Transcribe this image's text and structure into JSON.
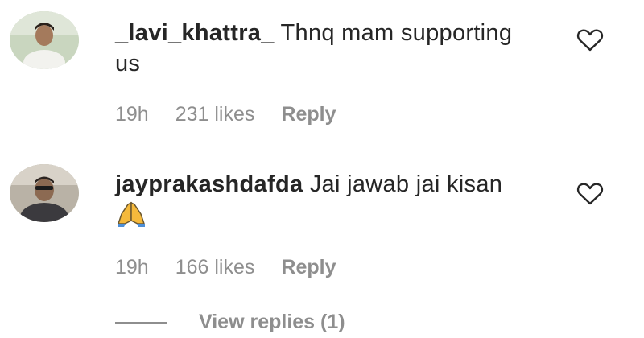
{
  "comments": [
    {
      "username": "_lavi_khattra_",
      "text": "Thnq mam supporting us",
      "time": "19h",
      "likes": "231 likes",
      "reply": "Reply",
      "avatar_icon": "user-avatar-photo",
      "heart_icon": "heart-outline-icon"
    },
    {
      "username": "jayprakashdafda",
      "text": "Jai jawab jai kisan",
      "emoji": "🙏",
      "time": "19h",
      "likes": "166 likes",
      "reply": "Reply",
      "avatar_icon": "user-avatar-photo",
      "heart_icon": "heart-outline-icon"
    }
  ],
  "view_replies": "View replies (1)",
  "colors": {
    "text": "#262626",
    "muted": "#8e8e8e"
  }
}
